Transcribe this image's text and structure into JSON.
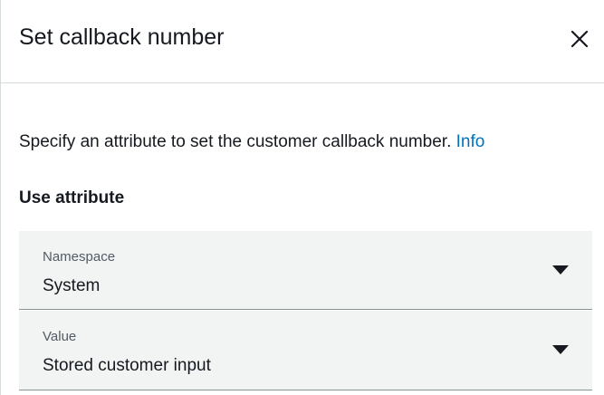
{
  "header": {
    "title": "Set callback number",
    "close_icon": "close-icon"
  },
  "body": {
    "description": "Specify an attribute to set the customer callback number.",
    "info_link": "Info",
    "section_label": "Use attribute"
  },
  "fields": {
    "namespace": {
      "label": "Namespace",
      "value": "System",
      "icon": "caret-down-icon"
    },
    "value": {
      "label": "Value",
      "value": "Stored customer input",
      "icon": "caret-down-icon"
    }
  },
  "colors": {
    "link": "#0073bb",
    "field_background": "#f2f3f3",
    "border": "#d5dbdb",
    "text": "#16191f"
  }
}
